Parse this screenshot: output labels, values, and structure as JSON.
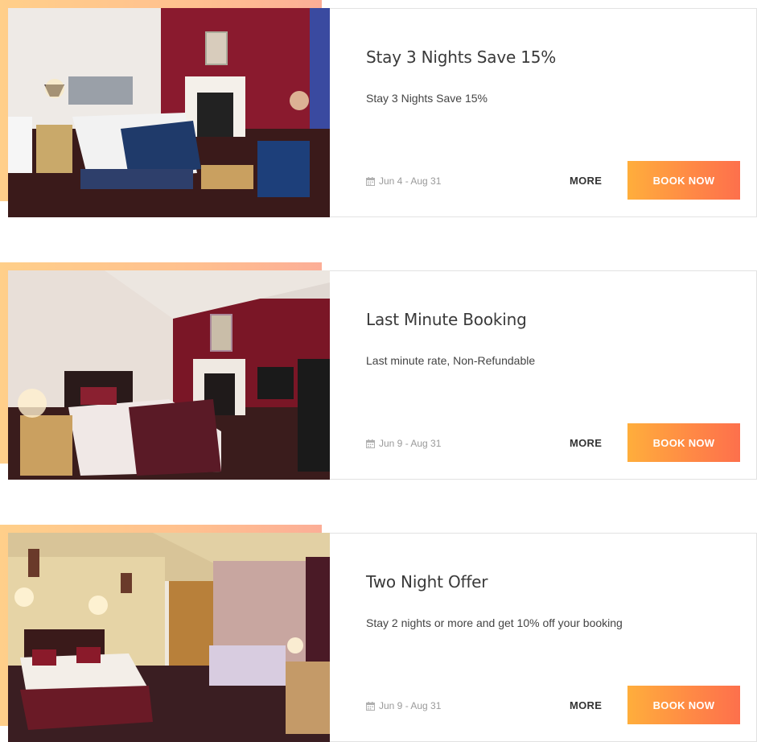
{
  "offers": [
    {
      "title": "Stay 3 Nights Save 15%",
      "description": "Stay 3 Nights Save 15%",
      "dates": "Jun 4 - Aug 31",
      "more_label": "MORE",
      "book_label": "BOOK NOW",
      "image": "hotel-room-photo"
    },
    {
      "title": "Last Minute Booking",
      "description": "Last minute rate, Non-Refundable",
      "dates": "Jun 9 - Aug 31",
      "more_label": "MORE",
      "book_label": "BOOK NOW",
      "image": "hotel-room-photo"
    },
    {
      "title": "Two Night Offer",
      "description": "Stay 2 nights or more and get 10% off your booking",
      "dates": "Jun 9 - Aug 31",
      "more_label": "MORE",
      "book_label": "BOOK NOW",
      "image": "hotel-room-photo"
    }
  ],
  "colors": {
    "accent_start": "#ffcf8a",
    "accent_end": "#fcae97",
    "button_start": "#ffae3c",
    "button_end": "#fd704c",
    "title": "#3a3a3a",
    "date": "#9a9a9a"
  },
  "icons": {
    "date_icon": "calendar-icon"
  }
}
